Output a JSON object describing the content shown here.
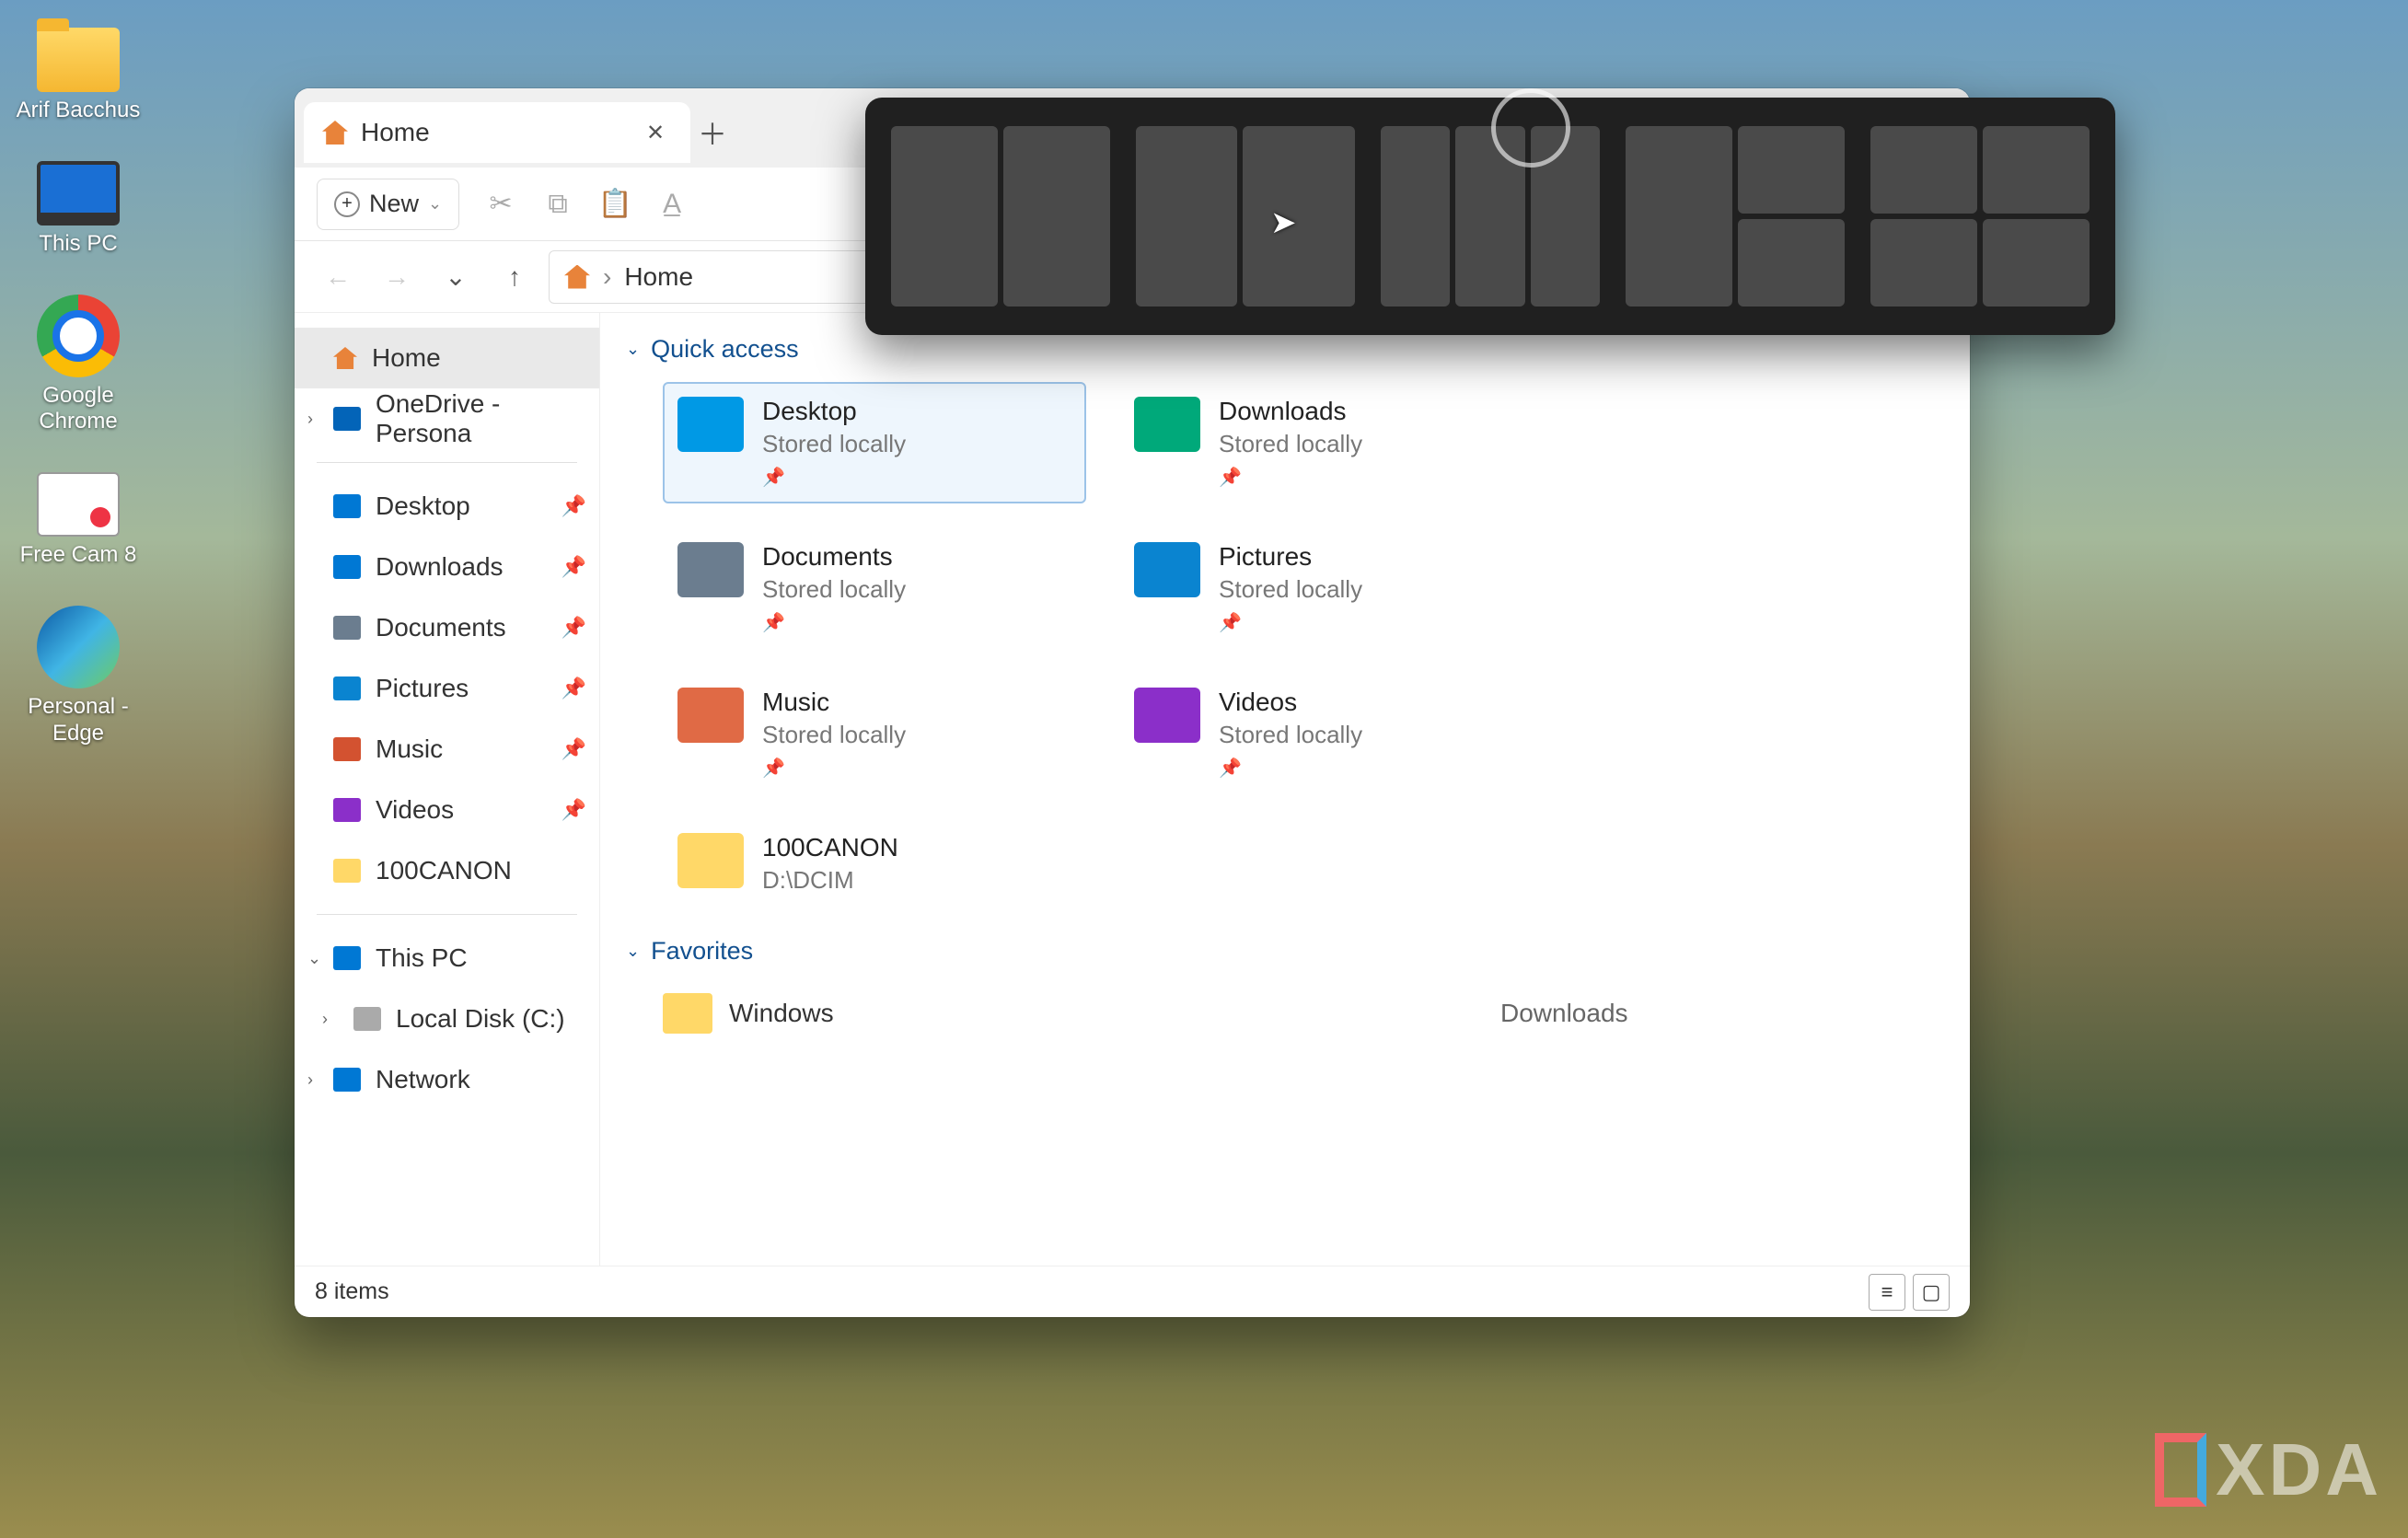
{
  "desktop_icons": [
    {
      "name": "Arif Bacchus"
    },
    {
      "name": "This PC"
    },
    {
      "name": "Google Chrome"
    },
    {
      "name": "Free Cam 8"
    },
    {
      "name": "Personal - Edge"
    }
  ],
  "explorer": {
    "tab_title": "Home",
    "toolbar": {
      "new_label": "New"
    },
    "breadcrumb": {
      "current": "Home"
    },
    "sidebar": {
      "home": "Home",
      "onedrive": "OneDrive - Persona",
      "desktop": "Desktop",
      "downloads": "Downloads",
      "documents": "Documents",
      "pictures": "Pictures",
      "music": "Music",
      "videos": "Videos",
      "canon": "100CANON",
      "thispc": "This PC",
      "localdisk": "Local Disk (C:)",
      "network": "Network"
    },
    "sections": {
      "quick_access": "Quick access",
      "favorites": "Favorites"
    },
    "quick_access": [
      {
        "name": "Desktop",
        "sub": "Stored locally",
        "cls": "big-desktop",
        "sel": true
      },
      {
        "name": "Downloads",
        "sub": "Stored locally",
        "cls": "big-downloads",
        "sel": false
      },
      {
        "name": "Documents",
        "sub": "Stored locally",
        "cls": "big-documents",
        "sel": false
      },
      {
        "name": "Pictures",
        "sub": "Stored locally",
        "cls": "big-pictures",
        "sel": false
      },
      {
        "name": "Music",
        "sub": "Stored locally",
        "cls": "big-music",
        "sel": false
      },
      {
        "name": "Videos",
        "sub": "Stored locally",
        "cls": "big-videos",
        "sel": false
      },
      {
        "name": "100CANON",
        "sub": "D:\\DCIM",
        "cls": "big-folder",
        "sel": false
      }
    ],
    "favorites": [
      {
        "name": "Windows",
        "sub": "Downloads"
      }
    ],
    "status": {
      "item_count": "8 items"
    }
  },
  "watermark": "XDA"
}
